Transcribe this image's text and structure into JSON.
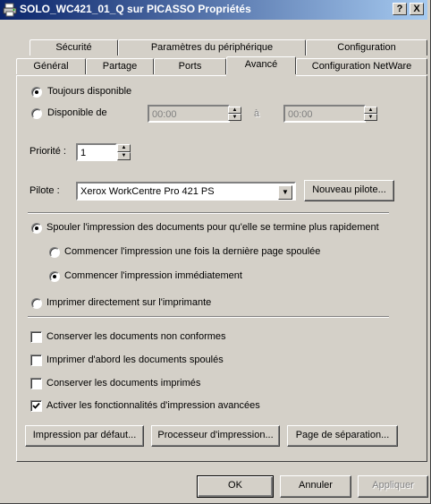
{
  "window": {
    "title": "SOLO_WC421_01_Q sur PICASSO Propriétés",
    "help_label": "?",
    "close_label": "X"
  },
  "tabs_back": [
    "Sécurité",
    "Paramètres du périphérique",
    "Configuration"
  ],
  "tabs_front": [
    "Général",
    "Partage",
    "Ports",
    "Avancé",
    "Configuration NetWare"
  ],
  "active_tab": "Avancé",
  "availability": {
    "always_label": "Toujours disponible",
    "always_selected": true,
    "from_label": "Disponible de",
    "from_selected": false,
    "start_time": "00:00",
    "to_label": "à",
    "end_time": "00:00"
  },
  "priority": {
    "label": "Priorité :",
    "value": "1"
  },
  "driver": {
    "label": "Pilote :",
    "value": "Xerox WorkCentre Pro 421 PS",
    "new_button": "Nouveau pilote..."
  },
  "spool": {
    "spool_label": "Spouler l'impression des documents pour qu'elle se termine plus rapidement",
    "spool_selected": true,
    "after_last_page_label": "Commencer l'impression une fois la dernière page spoulée",
    "after_last_page_selected": false,
    "immediately_label": "Commencer l'impression immédiatement",
    "immediately_selected": true,
    "direct_label": "Imprimer directement sur l'imprimante",
    "direct_selected": false
  },
  "options": [
    {
      "label": "Conserver les documents non conformes",
      "checked": false
    },
    {
      "label": "Imprimer d'abord les documents spoulés",
      "checked": false
    },
    {
      "label": "Conserver les documents imprimés",
      "checked": false
    },
    {
      "label": "Activer les fonctionnalités d'impression avancées",
      "checked": true
    }
  ],
  "bottom_buttons": [
    "Impression par défaut...",
    "Processeur d'impression...",
    "Page de séparation..."
  ],
  "dialog_buttons": {
    "ok": "OK",
    "cancel": "Annuler",
    "apply": "Appliquer"
  }
}
